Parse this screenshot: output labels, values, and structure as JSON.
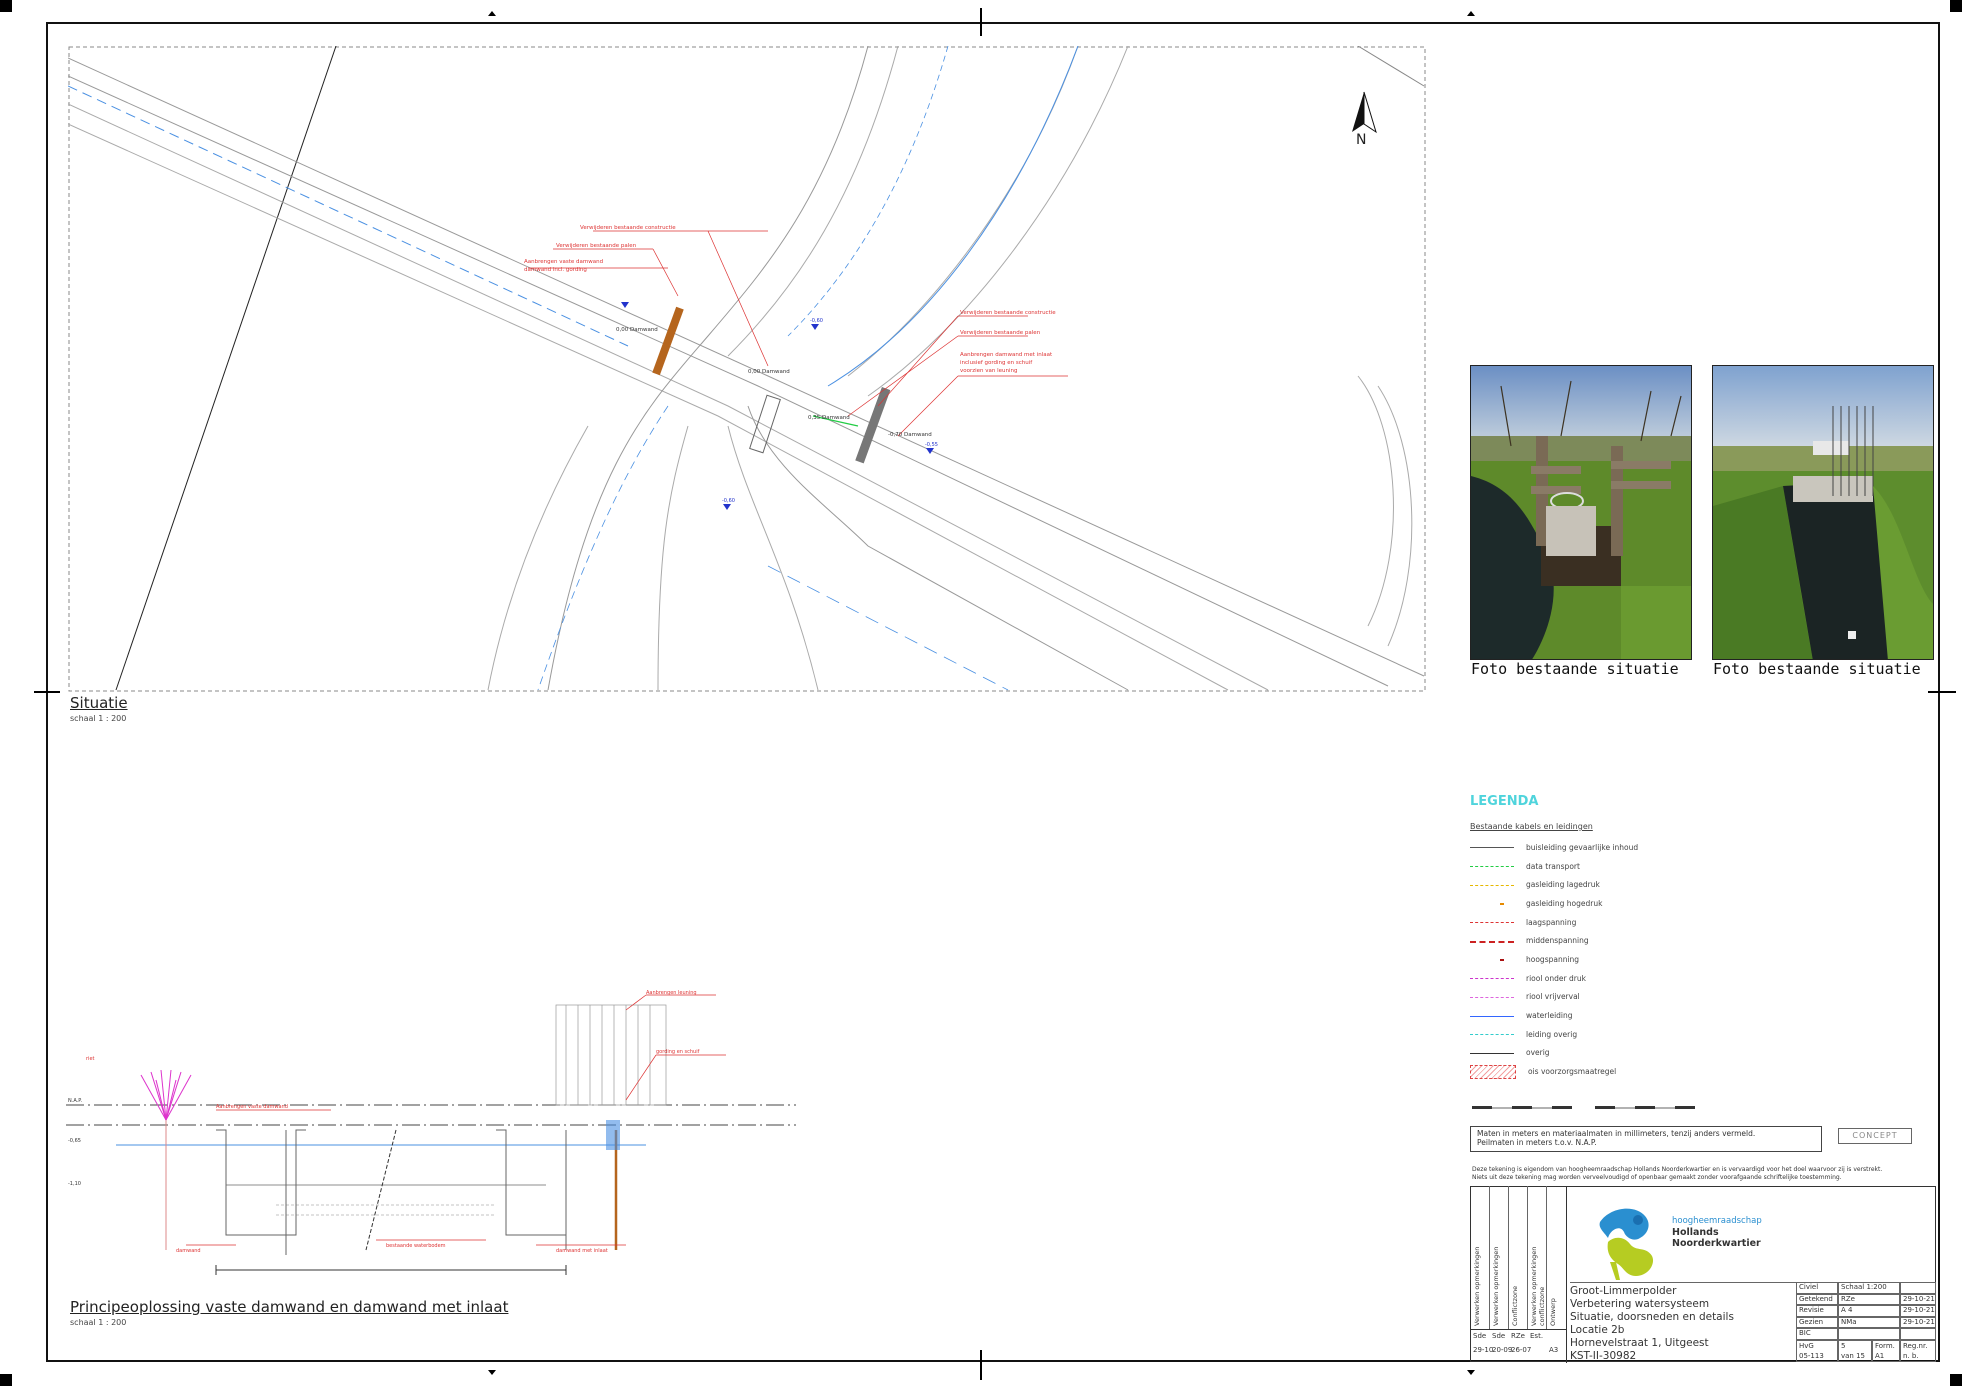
{
  "drawing": {
    "situation_title": "Situatie",
    "situation_scale": "schaal 1 : 200",
    "north_label": "N",
    "section_title": "Principeoplossing vaste damwand en damwand met inlaat",
    "section_scale": "schaal 1 : 200",
    "map_labels": {
      "level_1": "0,00 Damwand",
      "level_2": "0,00 Damwand",
      "level_3": "0,35 Damwand",
      "level_4": "-0,70 Damwand"
    }
  },
  "photos": [
    {
      "caption": "Foto bestaande situatie"
    },
    {
      "caption": "Foto bestaande situatie"
    }
  ],
  "legend": {
    "title": "LEGENDA",
    "subtitle": "Bestaande kabels en leidingen",
    "items": [
      {
        "label": "buisleiding gevaarlijke inhoud",
        "color": "#555555",
        "style": "solid"
      },
      {
        "label": "data transport",
        "color": "#22cc44",
        "style": "dashed"
      },
      {
        "label": "gasleiding lagedruk",
        "color": "#e6b800",
        "style": "dashed"
      },
      {
        "label": "gasleiding hogedruk",
        "color": "#e68a00",
        "style": "dot"
      },
      {
        "label": "laagspanning",
        "color": "#dd3333",
        "style": "dashed"
      },
      {
        "label": "middenspanning",
        "color": "#cc2222",
        "style": "dashed"
      },
      {
        "label": "hoogspanning",
        "color": "#aa1111",
        "style": "dot"
      },
      {
        "label": "riool onder druk",
        "color": "#cc33cc",
        "style": "dashed"
      },
      {
        "label": "riool vrijverval",
        "color": "#dd66dd",
        "style": "dashed"
      },
      {
        "label": "waterleiding",
        "color": "#3366ff",
        "style": "solid"
      },
      {
        "label": "leiding overig",
        "color": "#33cccc",
        "style": "dashed"
      },
      {
        "label": "overig",
        "color": "#333333",
        "style": "solid"
      },
      {
        "label": "ois voorzorgsmaatregel",
        "color": "#dd4444",
        "style": "hatch"
      }
    ]
  },
  "notes": {
    "line1": "Maten in meters en materiaalmaten in millimeters, tenzij anders vermeld.",
    "line2": "Peilmaten in meters t.o.v. N.A.P.",
    "stamp": "CONCEPT"
  },
  "disclaimer": {
    "line1": "Deze tekening is eigendom van hoogheemraadschap Hollands Noorderkwartier en is vervaardigd voor het doel waarvoor zij is verstrekt.",
    "line2": "Niets uit deze tekening mag worden verveelvoudigd of openbaar gemaakt zonder voorafgaande schriftelijke toestemming."
  },
  "organization": {
    "line1": "hoogheemraadschap",
    "line2": "Hollands",
    "line3": "Noorderkwartier",
    "logo_colors": {
      "blue": "#2a8fd0",
      "green": "#b6cc22"
    }
  },
  "project": {
    "name": "Groot-Limmerpolder",
    "subtitle": "Verbetering watersysteem",
    "description": "Situatie, doorsneden en details",
    "location": "Locatie 2b",
    "address": "Hornevelstraat 1, Uitgeest",
    "number": "KST-II-30982"
  },
  "meta": [
    {
      "key": "Civiel",
      "val": "Schaal 1:200",
      "date": ""
    },
    {
      "key": "Getekend",
      "val": "RZe",
      "date": "29-10-21"
    },
    {
      "key": "Revisie",
      "val": "A 4",
      "date": "29-10-21"
    },
    {
      "key": "Gezien",
      "val": "NMa",
      "date": "29-10-21"
    },
    {
      "key": "BIC",
      "val": "",
      "date": ""
    }
  ],
  "footer_meta": {
    "c1": "HvG",
    "c2": "05-113",
    "c3": "5",
    "c4": "van 15",
    "c5": "Form.",
    "c6": "A1",
    "c7": "Reg.nr.",
    "c8": "n. b."
  },
  "revisions": [
    {
      "label": "Verwerken opmerkingen",
      "who": "Sde",
      "date": "29-10"
    },
    {
      "label": "Verwerken opmerkingen",
      "who": "Sde",
      "date": "20-09"
    },
    {
      "label": "Conflictzone",
      "who": "RZe",
      "date": "26-07"
    },
    {
      "label": "Verwerken opmerkingen conflictzone",
      "who": "Est.",
      "date": "Est."
    },
    {
      "label": "Ontwerp",
      "who": "Est.",
      "date": "A3"
    }
  ]
}
